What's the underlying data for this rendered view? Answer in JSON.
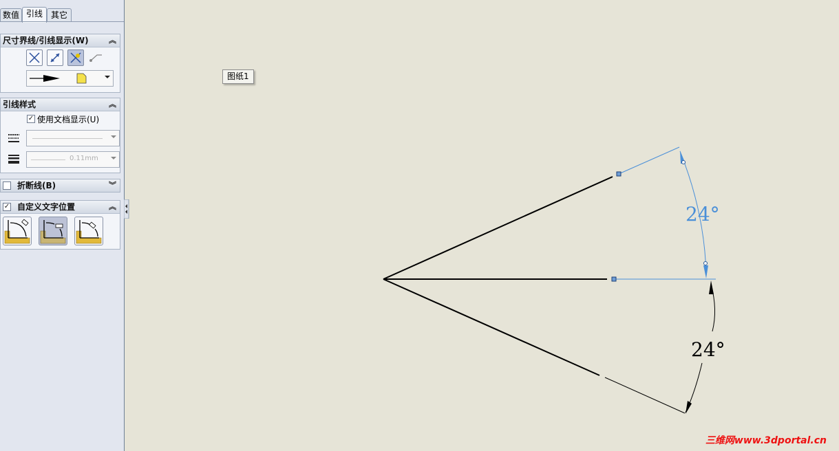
{
  "tabs": [
    {
      "label": "数值",
      "active": false
    },
    {
      "label": "引线",
      "active": true
    },
    {
      "label": "其它",
      "active": false
    }
  ],
  "group_witness": {
    "title": "尺寸界线/引线显示(W)"
  },
  "group_leader_style": {
    "title": "引线样式",
    "use_document_label": "使用文档显示(U)",
    "use_document_checked": true,
    "line_style_value": "",
    "thickness_value": "0.11mm"
  },
  "group_break": {
    "title": "折断线(B)",
    "checked": false
  },
  "group_custom_text": {
    "title": "自定义文字位置",
    "checked": true
  },
  "sheet_label": "图纸1",
  "drawing": {
    "dimension_upper": "24°",
    "dimension_lower": "24°",
    "selected_color": "#4a8fd8",
    "line_color": "#000000"
  },
  "watermark": "三维网www.3dportal.cn"
}
